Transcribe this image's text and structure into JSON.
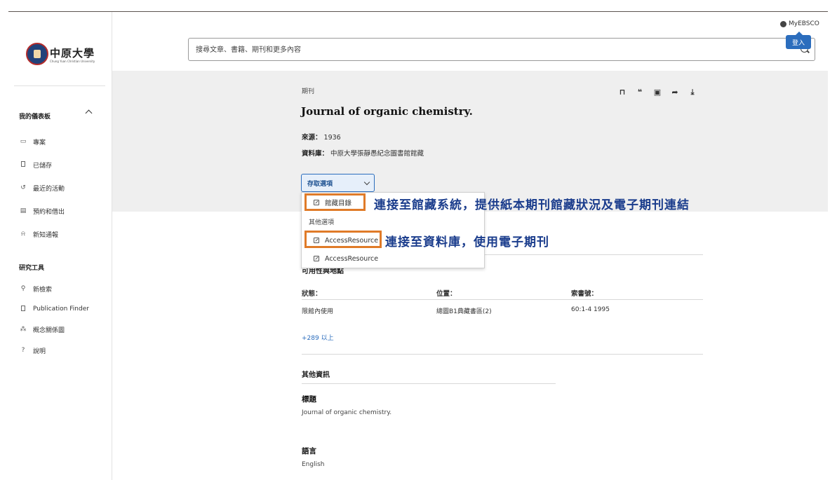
{
  "brand": {
    "logo_cn": "中原大學",
    "logo_en": "Chung Yuan Christian University"
  },
  "header": {
    "search_placeholder": "搜尋文章、書籍、期刊和更多內容",
    "myebsco": "MyEBSCO",
    "login_tooltip": "登入"
  },
  "sidebar": {
    "dashboard_title": "我的儀表板",
    "dashboard_items": [
      {
        "label": "專案",
        "icon": "folder-icon"
      },
      {
        "label": "已儲存",
        "icon": "bookmark-icon"
      },
      {
        "label": "最近的活動",
        "icon": "history-icon"
      },
      {
        "label": "預約和借出",
        "icon": "book-icon"
      },
      {
        "label": "新知通報",
        "icon": "bell-icon"
      }
    ],
    "tools_title": "研究工具",
    "tools_items": [
      {
        "label": "新檢索",
        "icon": "search-icon"
      },
      {
        "label": "Publication Finder",
        "icon": "document-icon"
      },
      {
        "label": "概念關係圖",
        "icon": "concept-map-icon"
      },
      {
        "label": "說明",
        "icon": "help-icon"
      }
    ]
  },
  "record": {
    "type": "期刊",
    "title": "Journal of organic chemistry.",
    "source_label": "來源：",
    "source_value": "1936",
    "database_label": "資料庫：",
    "database_value": "中原大學張靜愚紀念圖書館館藏",
    "actions": [
      "bookmark-icon",
      "quote-icon",
      "folder-add-icon",
      "share-icon",
      "download-icon"
    ]
  },
  "access": {
    "button_label": "存取選項",
    "menu": {
      "item1": "館藏目錄",
      "subheading": "其他選項",
      "item2": "AccessResource",
      "item3": "AccessResource"
    },
    "callout1": "連接至館藏系統，提供紙本期刊館藏狀況及電子期刊連結",
    "callout2": "連接至資料庫，使用電子期刊",
    "highlight_color": "#e07b29",
    "callout_color": "#1a3c8c"
  },
  "holdings": {
    "title": "可用性與地點",
    "columns": [
      "狀態：",
      "位置：",
      "索書號："
    ],
    "row": [
      "限館內使用",
      "總圖B1典藏書區(2)",
      "60:1-4 1995"
    ],
    "more": "+289 以上"
  },
  "other_info": {
    "title": "其他資訊",
    "title_label": "標題",
    "title_value": "Journal of organic chemistry.",
    "language_label": "語言",
    "language_value": "English"
  },
  "colors": {
    "accent": "#2b6dbd",
    "band": "#efefef"
  }
}
